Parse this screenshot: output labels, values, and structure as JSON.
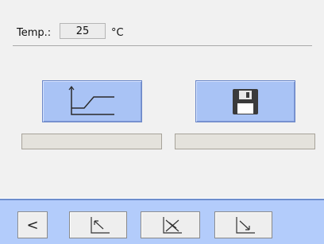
{
  "temperature": {
    "label": "Temp.:",
    "value": "25",
    "unit": "°C"
  },
  "actions": {
    "profile_icon": "temperature-profile-icon",
    "save_icon": "floppy-disk-icon"
  },
  "progress": {
    "left_fraction": 0,
    "right_fraction": 0
  },
  "nav": {
    "back_label": "<",
    "buttons": [
      "ramp-up-left-icon",
      "cancel-ramp-icon",
      "ramp-down-right-icon"
    ]
  },
  "colors": {
    "accent_blue": "#a9c3f5",
    "bar_blue": "#b3ccfb"
  }
}
